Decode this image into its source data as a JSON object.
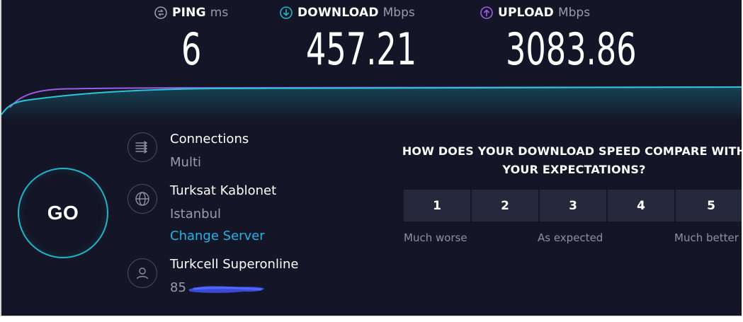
{
  "colors": {
    "background": "#141526",
    "download_accent": "#1fb6c9",
    "upload_accent": "#9b5de5",
    "ping_icon": "#9a9cae",
    "link": "#1fb6e6",
    "rating_button_bg": "#26283b"
  },
  "results": {
    "ping": {
      "icon": "ping-icon",
      "label": "PING",
      "unit": "ms",
      "value": "6"
    },
    "download": {
      "icon": "download-arrow-icon",
      "label": "DOWNLOAD",
      "unit": "Mbps",
      "value": "457.21"
    },
    "upload": {
      "icon": "upload-arrow-icon",
      "label": "UPLOAD",
      "unit": "Mbps",
      "value": "3083.86"
    }
  },
  "go_button": {
    "label": "GO"
  },
  "connections": {
    "icon": "connections-arrows-icon",
    "title": "Connections",
    "value": "Multi"
  },
  "server": {
    "icon": "globe-icon",
    "name": "Turksat Kablonet",
    "location": "Istanbul",
    "change_link": "Change Server"
  },
  "provider": {
    "icon": "user-icon",
    "name": "Turkcell Superonline",
    "ip_visible": "85"
  },
  "survey": {
    "question": "HOW DOES YOUR DOWNLOAD SPEED COMPARE WITH YOUR EXPECTATIONS?",
    "ratings": [
      "1",
      "2",
      "3",
      "4",
      "5"
    ],
    "scale_labels": {
      "low": "Much worse",
      "mid": "As expected",
      "high": "Much better"
    }
  }
}
